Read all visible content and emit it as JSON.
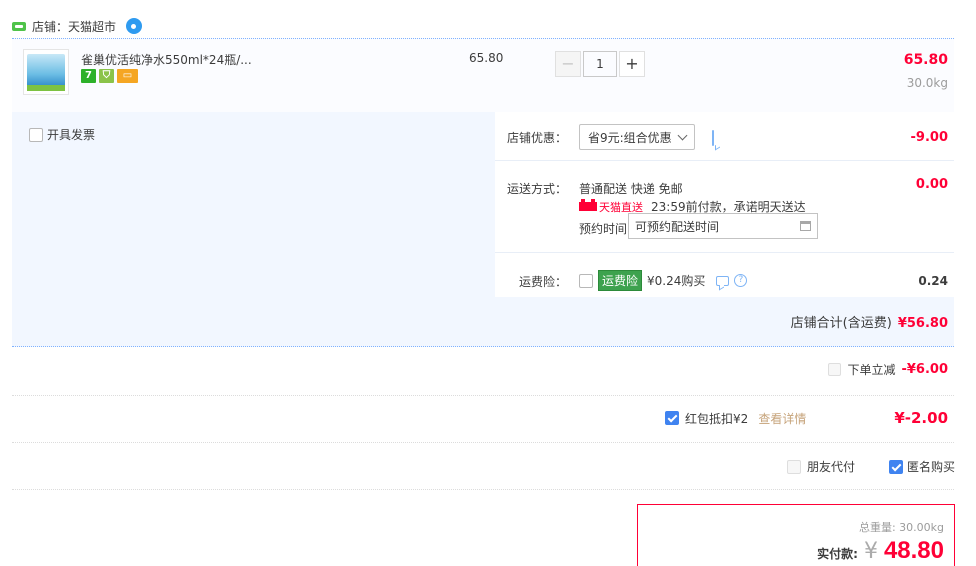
{
  "shop": {
    "name": "店铺：天猫超市"
  },
  "item": {
    "title": "雀巢优活纯净水550ml*24瓶/...",
    "badge_7": "7",
    "unit_price": "65.80",
    "quantity": "1",
    "minus": "−",
    "plus": "+",
    "line_total": "65.80",
    "weight": "30.0kg"
  },
  "options": {
    "invoice_label": "开具发票",
    "shop_discount_label": "店铺优惠：",
    "shop_discount_value": "省9元:组合优惠",
    "shop_discount_amount": "-9.00",
    "shipping_label": "运送方式：",
    "shipping_method": "普通配送 快递 免邮",
    "tmall_direct": "天猫直送",
    "delivery_promise": "23:59前付款，承诺明天送达",
    "schedule_label": "预约时间",
    "schedule_placeholder": "可预约配送时间",
    "shipping_amount": "0.00",
    "insurance_label": "运费险：",
    "insurance_tag": "运费险",
    "insurance_desc": "¥0.24购买",
    "insurance_help": "?",
    "insurance_amount": "0.24",
    "subtotal_label": "店铺合计(含运费)",
    "subtotal_value": "¥56.80"
  },
  "summary": {
    "instant_discount_label": "下单立减",
    "instant_discount_value": "-¥6.00",
    "redpacket_label": "红包抵扣¥2",
    "redpacket_link": "查看详情",
    "redpacket_value": "¥-2.00",
    "friend_pay_label": "朋友代付",
    "anonymous_label": "匿名购买"
  },
  "payment": {
    "total_weight": "总重量: 30.00kg",
    "label": "实付款:",
    "currency": "¥",
    "amount": "48.80"
  },
  "colors": {
    "price_red": "#ff0036",
    "dotted_blue": "#80b2ff",
    "panel_bg": "#f2f7ff",
    "checkbox_blue": "#3f83f0"
  }
}
